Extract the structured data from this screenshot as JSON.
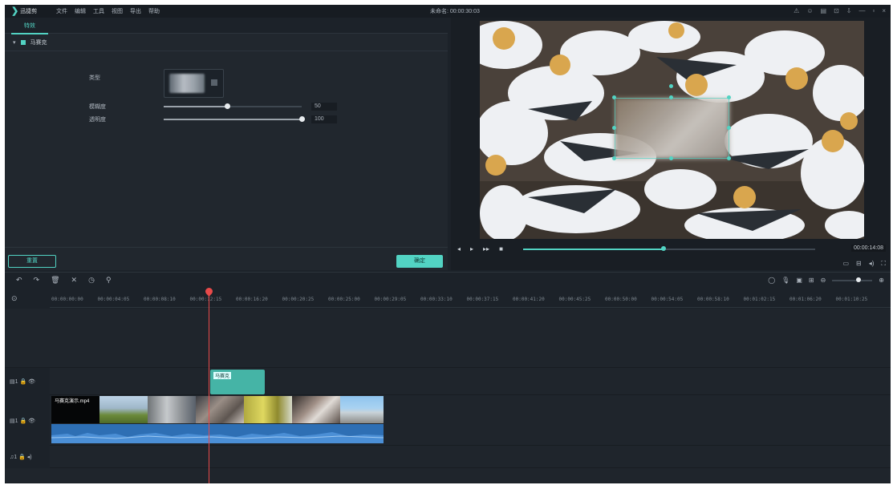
{
  "app": {
    "logo_mark": "❯",
    "logo_text": "迅捷剪",
    "menu": [
      "文件",
      "编辑",
      "工具",
      "视图",
      "导出",
      "帮助"
    ],
    "project_title": "未命名: 00:00:30:03",
    "window_icons": [
      "⚠",
      "☺",
      "▤",
      "⊡",
      "⇩",
      "—",
      "▫",
      "×"
    ]
  },
  "left_panel": {
    "tab": "特效",
    "section": "马赛克",
    "type_label": "类型",
    "blur_label": "模糊度",
    "blur_value": "50",
    "blur_level": 0.46,
    "opacity_label": "透明度",
    "opacity_value": "100",
    "opacity_level": 1.0,
    "reset_button": "重置",
    "ok_button": "确定"
  },
  "preview": {
    "time_code": "00:00:14:08",
    "progress": 0.48,
    "transport_icons": [
      "◂",
      "▸",
      "▸▸",
      "■"
    ],
    "icons": [
      "▭",
      "⊟",
      "◂)",
      "⛶"
    ]
  },
  "toolbar": {
    "tools": [
      "↶",
      "↷",
      "🗑",
      "✕",
      "◷",
      "⚲"
    ],
    "zoom_icons": [
      "◯",
      "🎙",
      "▣",
      "⊞",
      "⊖",
      "⊕"
    ]
  },
  "timeline": {
    "ruler_labels": [
      "00:00:00:00",
      "00:00:04:05",
      "00:00:08:10",
      "00:00:12:15",
      "00:00:16:20",
      "00:00:20:25",
      "00:00:25:00",
      "00:00:29:05",
      "00:00:33:10",
      "00:00:37:15",
      "00:00:41:20",
      "00:00:45:25",
      "00:00:50:00",
      "00:00:54:05",
      "00:00:58:10",
      "00:01:02:15",
      "00:01:06:20",
      "00:01:10:25"
    ],
    "effect_clip_label": "马赛克",
    "video_clip_title": "马赛克演示.mp4",
    "track_heads": [
      "▤1 🔒 👁",
      "▤1 🔒 👁",
      "♫1 🔒 ◂)"
    ]
  },
  "colors": {
    "accent": "#52d3c3",
    "playhead": "#e84a4a",
    "audio": "#2e6fb4"
  }
}
